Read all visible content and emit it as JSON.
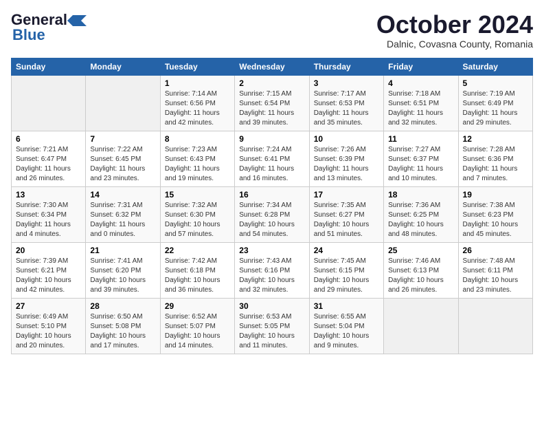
{
  "logo": {
    "general": "General",
    "blue": "Blue"
  },
  "title": "October 2024",
  "subtitle": "Dalnic, Covasna County, Romania",
  "days_header": [
    "Sunday",
    "Monday",
    "Tuesday",
    "Wednesday",
    "Thursday",
    "Friday",
    "Saturday"
  ],
  "weeks": [
    [
      {
        "day": "",
        "info": ""
      },
      {
        "day": "",
        "info": ""
      },
      {
        "day": "1",
        "info": "Sunrise: 7:14 AM\nSunset: 6:56 PM\nDaylight: 11 hours and 42 minutes."
      },
      {
        "day": "2",
        "info": "Sunrise: 7:15 AM\nSunset: 6:54 PM\nDaylight: 11 hours and 39 minutes."
      },
      {
        "day": "3",
        "info": "Sunrise: 7:17 AM\nSunset: 6:53 PM\nDaylight: 11 hours and 35 minutes."
      },
      {
        "day": "4",
        "info": "Sunrise: 7:18 AM\nSunset: 6:51 PM\nDaylight: 11 hours and 32 minutes."
      },
      {
        "day": "5",
        "info": "Sunrise: 7:19 AM\nSunset: 6:49 PM\nDaylight: 11 hours and 29 minutes."
      }
    ],
    [
      {
        "day": "6",
        "info": "Sunrise: 7:21 AM\nSunset: 6:47 PM\nDaylight: 11 hours and 26 minutes."
      },
      {
        "day": "7",
        "info": "Sunrise: 7:22 AM\nSunset: 6:45 PM\nDaylight: 11 hours and 23 minutes."
      },
      {
        "day": "8",
        "info": "Sunrise: 7:23 AM\nSunset: 6:43 PM\nDaylight: 11 hours and 19 minutes."
      },
      {
        "day": "9",
        "info": "Sunrise: 7:24 AM\nSunset: 6:41 PM\nDaylight: 11 hours and 16 minutes."
      },
      {
        "day": "10",
        "info": "Sunrise: 7:26 AM\nSunset: 6:39 PM\nDaylight: 11 hours and 13 minutes."
      },
      {
        "day": "11",
        "info": "Sunrise: 7:27 AM\nSunset: 6:37 PM\nDaylight: 11 hours and 10 minutes."
      },
      {
        "day": "12",
        "info": "Sunrise: 7:28 AM\nSunset: 6:36 PM\nDaylight: 11 hours and 7 minutes."
      }
    ],
    [
      {
        "day": "13",
        "info": "Sunrise: 7:30 AM\nSunset: 6:34 PM\nDaylight: 11 hours and 4 minutes."
      },
      {
        "day": "14",
        "info": "Sunrise: 7:31 AM\nSunset: 6:32 PM\nDaylight: 11 hours and 0 minutes."
      },
      {
        "day": "15",
        "info": "Sunrise: 7:32 AM\nSunset: 6:30 PM\nDaylight: 10 hours and 57 minutes."
      },
      {
        "day": "16",
        "info": "Sunrise: 7:34 AM\nSunset: 6:28 PM\nDaylight: 10 hours and 54 minutes."
      },
      {
        "day": "17",
        "info": "Sunrise: 7:35 AM\nSunset: 6:27 PM\nDaylight: 10 hours and 51 minutes."
      },
      {
        "day": "18",
        "info": "Sunrise: 7:36 AM\nSunset: 6:25 PM\nDaylight: 10 hours and 48 minutes."
      },
      {
        "day": "19",
        "info": "Sunrise: 7:38 AM\nSunset: 6:23 PM\nDaylight: 10 hours and 45 minutes."
      }
    ],
    [
      {
        "day": "20",
        "info": "Sunrise: 7:39 AM\nSunset: 6:21 PM\nDaylight: 10 hours and 42 minutes."
      },
      {
        "day": "21",
        "info": "Sunrise: 7:41 AM\nSunset: 6:20 PM\nDaylight: 10 hours and 39 minutes."
      },
      {
        "day": "22",
        "info": "Sunrise: 7:42 AM\nSunset: 6:18 PM\nDaylight: 10 hours and 36 minutes."
      },
      {
        "day": "23",
        "info": "Sunrise: 7:43 AM\nSunset: 6:16 PM\nDaylight: 10 hours and 32 minutes."
      },
      {
        "day": "24",
        "info": "Sunrise: 7:45 AM\nSunset: 6:15 PM\nDaylight: 10 hours and 29 minutes."
      },
      {
        "day": "25",
        "info": "Sunrise: 7:46 AM\nSunset: 6:13 PM\nDaylight: 10 hours and 26 minutes."
      },
      {
        "day": "26",
        "info": "Sunrise: 7:48 AM\nSunset: 6:11 PM\nDaylight: 10 hours and 23 minutes."
      }
    ],
    [
      {
        "day": "27",
        "info": "Sunrise: 6:49 AM\nSunset: 5:10 PM\nDaylight: 10 hours and 20 minutes."
      },
      {
        "day": "28",
        "info": "Sunrise: 6:50 AM\nSunset: 5:08 PM\nDaylight: 10 hours and 17 minutes."
      },
      {
        "day": "29",
        "info": "Sunrise: 6:52 AM\nSunset: 5:07 PM\nDaylight: 10 hours and 14 minutes."
      },
      {
        "day": "30",
        "info": "Sunrise: 6:53 AM\nSunset: 5:05 PM\nDaylight: 10 hours and 11 minutes."
      },
      {
        "day": "31",
        "info": "Sunrise: 6:55 AM\nSunset: 5:04 PM\nDaylight: 10 hours and 9 minutes."
      },
      {
        "day": "",
        "info": ""
      },
      {
        "day": "",
        "info": ""
      }
    ]
  ]
}
